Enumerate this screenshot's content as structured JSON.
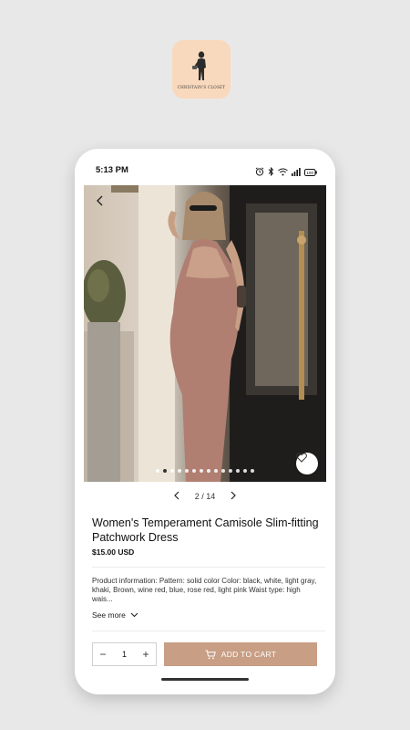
{
  "app": {
    "logo_text": "CHRISTAIN'S CLOSET",
    "logo_bg": "#f9d9bd"
  },
  "status_bar": {
    "time": "5:13 PM",
    "icons": [
      "alarm-icon",
      "bluetooth-icon",
      "wifi-icon",
      "signal-icon",
      "battery-icon"
    ],
    "battery": "100"
  },
  "gallery": {
    "back_icon": "back-arrow-icon",
    "favorite_icon": "heart-icon",
    "dot_count": 14,
    "active_index": 1,
    "pager_text": "2 / 14"
  },
  "product": {
    "title": "Women's Temperament Camisole Slim-fitting Patchwork Dress",
    "price": "$15.00 USD",
    "description": "Product information: Pattern: solid color Color: black, white, light gray, khaki, Brown, wine red, blue, rose red, light pink Waist type: high wais...",
    "see_more": "See more"
  },
  "purchase": {
    "quantity": "1",
    "minus": "−",
    "plus": "+",
    "add_to_cart": "ADD TO CART",
    "button_color": "#c89e84"
  }
}
